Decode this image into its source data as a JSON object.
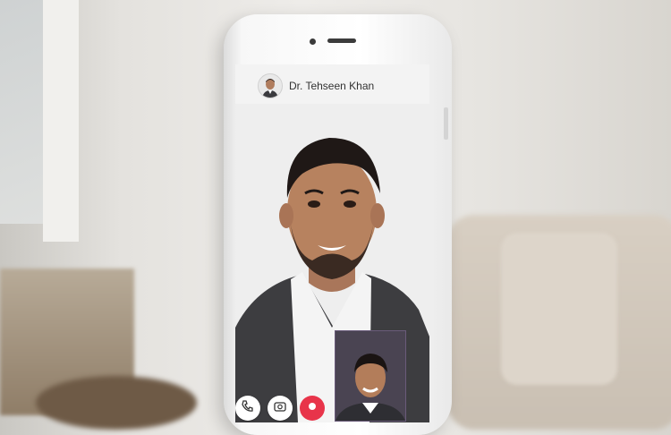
{
  "call": {
    "contact_name": "Dr. Tehseen Khan"
  },
  "controls": {
    "icons": [
      "phone-icon",
      "camera-switch-icon",
      "end-call-icon"
    ]
  },
  "colors": {
    "end_call": "#e8344a",
    "screen_bg": "#ebebeb"
  }
}
